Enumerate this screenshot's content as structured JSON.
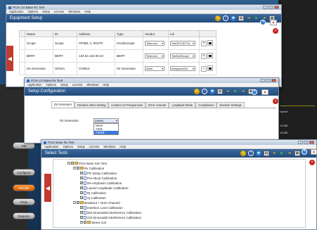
{
  "desktop": {
    "right_scope_texts": [
      "Spectr",
      "15.6M",
      "18.5M"
    ],
    "side_buttons": [
      {
        "label": "Sta",
        "active": false
      },
      {
        "label": "Configure",
        "active": false
      },
      {
        "label": "Results",
        "active": true
      },
      {
        "label": "Plots",
        "active": false
      },
      {
        "label": "Reports",
        "active": false
      }
    ]
  },
  "win1": {
    "title": "PCIe 3.0 Base Rx Test",
    "menu": [
      "Application",
      "Options",
      "Setup",
      "License",
      "Windows",
      "Help"
    ],
    "header": "Equipment Setup",
    "columns": [
      "Name",
      "ID",
      "Address",
      "Type",
      "Vendor",
      "Lib"
    ],
    "rows": [
      {
        "name": "Scope",
        "id": "Scope",
        "address": "GPIB0::1::INSTR",
        "type": "Oscilloscope",
        "vendor": "Tektronix",
        "lib": "TekDPOJETSc"
      },
      {
        "name": "BERT",
        "id": "BERT",
        "address": "134.62.132.60:23",
        "type": "BERT",
        "vendor": "Tektronix",
        "lib": "TekBertScope"
      },
      {
        "name": "ISI Generator",
        "id": "ISIGen",
        "address": "COM13",
        "type": "ISI Generator",
        "vendor": "Artek",
        "lib": "IntegratorSel"
      }
    ]
  },
  "win2": {
    "title": "PCIe 3.0 Base Rx Test",
    "menu": [
      "Application",
      "Options",
      "Setup",
      "License",
      "Windows",
      "Help"
    ],
    "header": "Setup Configuration",
    "tabs": [
      "ISI Generator",
      "Random Jitter Setting",
      "Custom SJ Frequencies",
      "Error Counter",
      "Loopback Mode",
      "Compliance",
      "Session Settings"
    ],
    "isi_label": "ISI Generator",
    "isi_value": "ArtekB",
    "isi_options": [
      "None",
      "Artek",
      "ArtekB"
    ]
  },
  "win3": {
    "title": "PCIe Base Rx Test",
    "menu": [
      "Application",
      "Options",
      "Setup",
      "License",
      "Windows",
      "Help"
    ],
    "header": "Select Tests",
    "tree": [
      {
        "level": 0,
        "label": "PCIe Base Sim Test",
        "kind": "root"
      },
      {
        "level": 1,
        "label": "Rx Calibration",
        "kind": "folder"
      },
      {
        "level": 2,
        "label": "PG Delay Calibration",
        "kind": "item"
      },
      {
        "level": 2,
        "label": "Pre-shoot Calibration",
        "kind": "item"
      },
      {
        "level": 2,
        "label": "De-emphasis Calibration",
        "kind": "item"
      },
      {
        "level": 2,
        "label": "Launch Amplitude Calibration",
        "kind": "item"
      },
      {
        "level": 2,
        "label": "Rj Calibration",
        "kind": "item"
      },
      {
        "level": 2,
        "label": "Sj Calibration",
        "kind": "item"
      },
      {
        "level": 1,
        "label": "Breakout + Nom Channel",
        "kind": "folder"
      },
      {
        "level": 2,
        "label": "Insertion Loss Calibration",
        "kind": "item"
      },
      {
        "level": 2,
        "label": "DM Sinusoidal Interference Calibration",
        "kind": "item"
      },
      {
        "level": 2,
        "label": "CM Sinusoidal Interference Calibration",
        "kind": "item"
      },
      {
        "level": 2,
        "label": "Stress Cal",
        "kind": "folder"
      }
    ]
  },
  "colors": {
    "header_blue": "#2c5a8e",
    "accent_red": "#c42a20",
    "active_orange": "#e2700c"
  }
}
